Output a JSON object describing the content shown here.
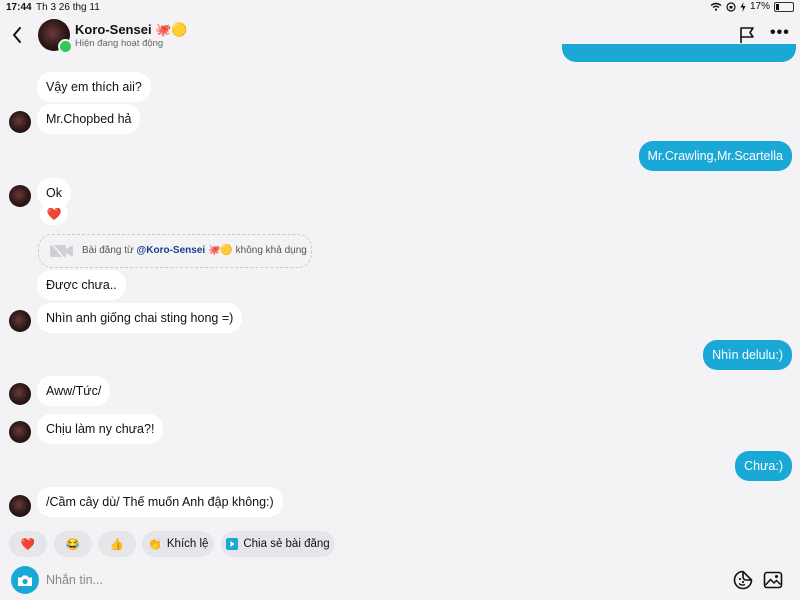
{
  "status_bar": {
    "time": "17:44",
    "date": "Th 3 26 thg 11",
    "battery": "17%",
    "battery_level": 0.17
  },
  "header": {
    "name": "Koro-Sensei 🐙🟡",
    "status": "Hiện đang hoạt động",
    "back_icon": "chevron-left-icon",
    "flag_icon": "flag-icon",
    "more_icon": "more-icon",
    "more_label": "•••"
  },
  "messages": [
    {
      "side": "in",
      "text": "Vậy em thích aii?"
    },
    {
      "side": "in",
      "text": "Mr.Chopbed hả",
      "avatar": true
    },
    {
      "side": "out",
      "text": "Mr.Crawling,Mr.Scartella"
    },
    {
      "side": "in",
      "text": "Ok",
      "avatar": true,
      "reaction": "❤️"
    },
    {
      "side": "system",
      "prefix": "Bài đăng từ",
      "handle": "@Koro-Sensei 🐙🟡",
      "suffix": "không khả dụng"
    },
    {
      "side": "in",
      "text": "Được chưa.."
    },
    {
      "side": "in",
      "text": "Nhìn anh giống chai sting hong =)",
      "avatar": true
    },
    {
      "side": "out",
      "text": "Nhìn delulu:)"
    },
    {
      "side": "in",
      "text": "Aww/Tức/",
      "avatar": true
    },
    {
      "side": "in",
      "text": "Chịu làm ny chưa?!",
      "avatar": true
    },
    {
      "side": "out",
      "text": "Chưa:)"
    },
    {
      "side": "in",
      "text": "/Cầm cây dù/ Thế muốn Anh đập không:)",
      "avatar": true
    }
  ],
  "quick_replies": [
    {
      "emoji": "❤️",
      "label": ""
    },
    {
      "emoji": "😂",
      "label": ""
    },
    {
      "emoji": "👍",
      "label": ""
    },
    {
      "emoji": "👏",
      "label": "Khích lệ"
    },
    {
      "icon": "share-icon",
      "label": "Chia sẻ bài đăng"
    }
  ],
  "composer": {
    "placeholder": "Nhắn tin...",
    "camera_icon": "camera-icon",
    "sticker_icon": "sticker-icon",
    "gallery_icon": "gallery-icon"
  },
  "colors": {
    "accent": "#1aa9d6",
    "background": "#f3f3f5",
    "online": "#34c759"
  }
}
